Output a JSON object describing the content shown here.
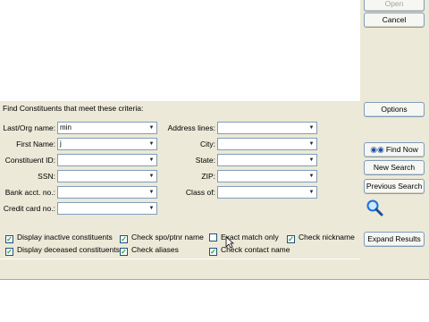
{
  "buttons": {
    "open": "Open",
    "cancel": "Cancel",
    "options": "Options",
    "find_now": "Find Now",
    "new_search": "New Search",
    "previous_search": "Previous Search",
    "expand_results": "Expand Results"
  },
  "criteria": {
    "title": "Find Constituents that meet these criteria:",
    "left_fields": [
      {
        "label": "Last/Org name:",
        "value": "min"
      },
      {
        "label": "First Name:",
        "value": "j"
      },
      {
        "label": "Constituent ID:",
        "value": ""
      },
      {
        "label": "SSN:",
        "value": ""
      },
      {
        "label": "Bank acct. no.:",
        "value": ""
      },
      {
        "label": "Credit card no.:",
        "value": ""
      }
    ],
    "right_fields": [
      {
        "label": "Address lines:",
        "value": ""
      },
      {
        "label": "City:",
        "value": ""
      },
      {
        "label": "State:",
        "value": ""
      },
      {
        "label": "ZIP:",
        "value": ""
      },
      {
        "label": "Class of:",
        "value": ""
      }
    ]
  },
  "checkboxes": [
    {
      "label": "Display inactive constituents",
      "checked": true
    },
    {
      "label": "Check spo/ptnr name",
      "checked": true
    },
    {
      "label": "Exact match only",
      "checked": false
    },
    {
      "label": "Check nickname",
      "checked": true
    },
    {
      "label": "Display deceased constituents",
      "checked": true
    },
    {
      "label": "Check aliases",
      "checked": true
    },
    {
      "label": "Check contact name",
      "checked": true
    }
  ],
  "icons": {
    "find_now": "binoculars-icon",
    "search": "magnifier-icon",
    "dropdown": "chevron-down-icon"
  },
  "colors": {
    "dialog_bg": "#ece9d8",
    "check_mark": "#21a121",
    "field_border": "#7f9db9"
  }
}
